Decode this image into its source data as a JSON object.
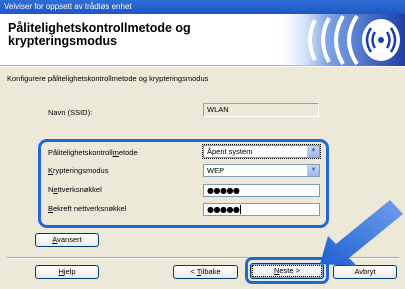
{
  "window": {
    "title": "Veiviser for oppsett av trådløs enhet"
  },
  "header": {
    "title": "Pålitelighetskontrollmetode og krypteringsmodus"
  },
  "description": "Konfigurere pålitelighetskontrollmetode og krypteringsmodus",
  "ssid": {
    "label": "Navn (SSID):",
    "value": "WLAN"
  },
  "form": {
    "auth_label_pre": "Pålitelighetskontroll",
    "auth_label_u": "m",
    "auth_label_post": "etode",
    "auth_value": "Åpent system",
    "enc_label_u": "K",
    "enc_label_post": "rypteringsmodus",
    "enc_value": "WEP",
    "key_label_pre": "N",
    "key_label_u": "e",
    "key_label_post": "ttverksnøkkel",
    "key_value": "●●●●●",
    "confirm_label_u": "B",
    "confirm_label_post": "ekreft nettverksnøkkel",
    "confirm_value": "●●●●●"
  },
  "buttons": {
    "advanced_u": "A",
    "advanced_post": "vansert",
    "help_u": "H",
    "help_post": "jelp",
    "back_pre": "< ",
    "back_u": "T",
    "back_post": "ilbake",
    "next_u": "N",
    "next_post": "este >",
    "cancel": "Avbryt"
  },
  "icon": "wireless-signal-icon",
  "colors": {
    "accent": "#2067d8",
    "titlebar": "#1f56c4",
    "logo": "#1c3fa8",
    "panel": "#ece9d8"
  }
}
